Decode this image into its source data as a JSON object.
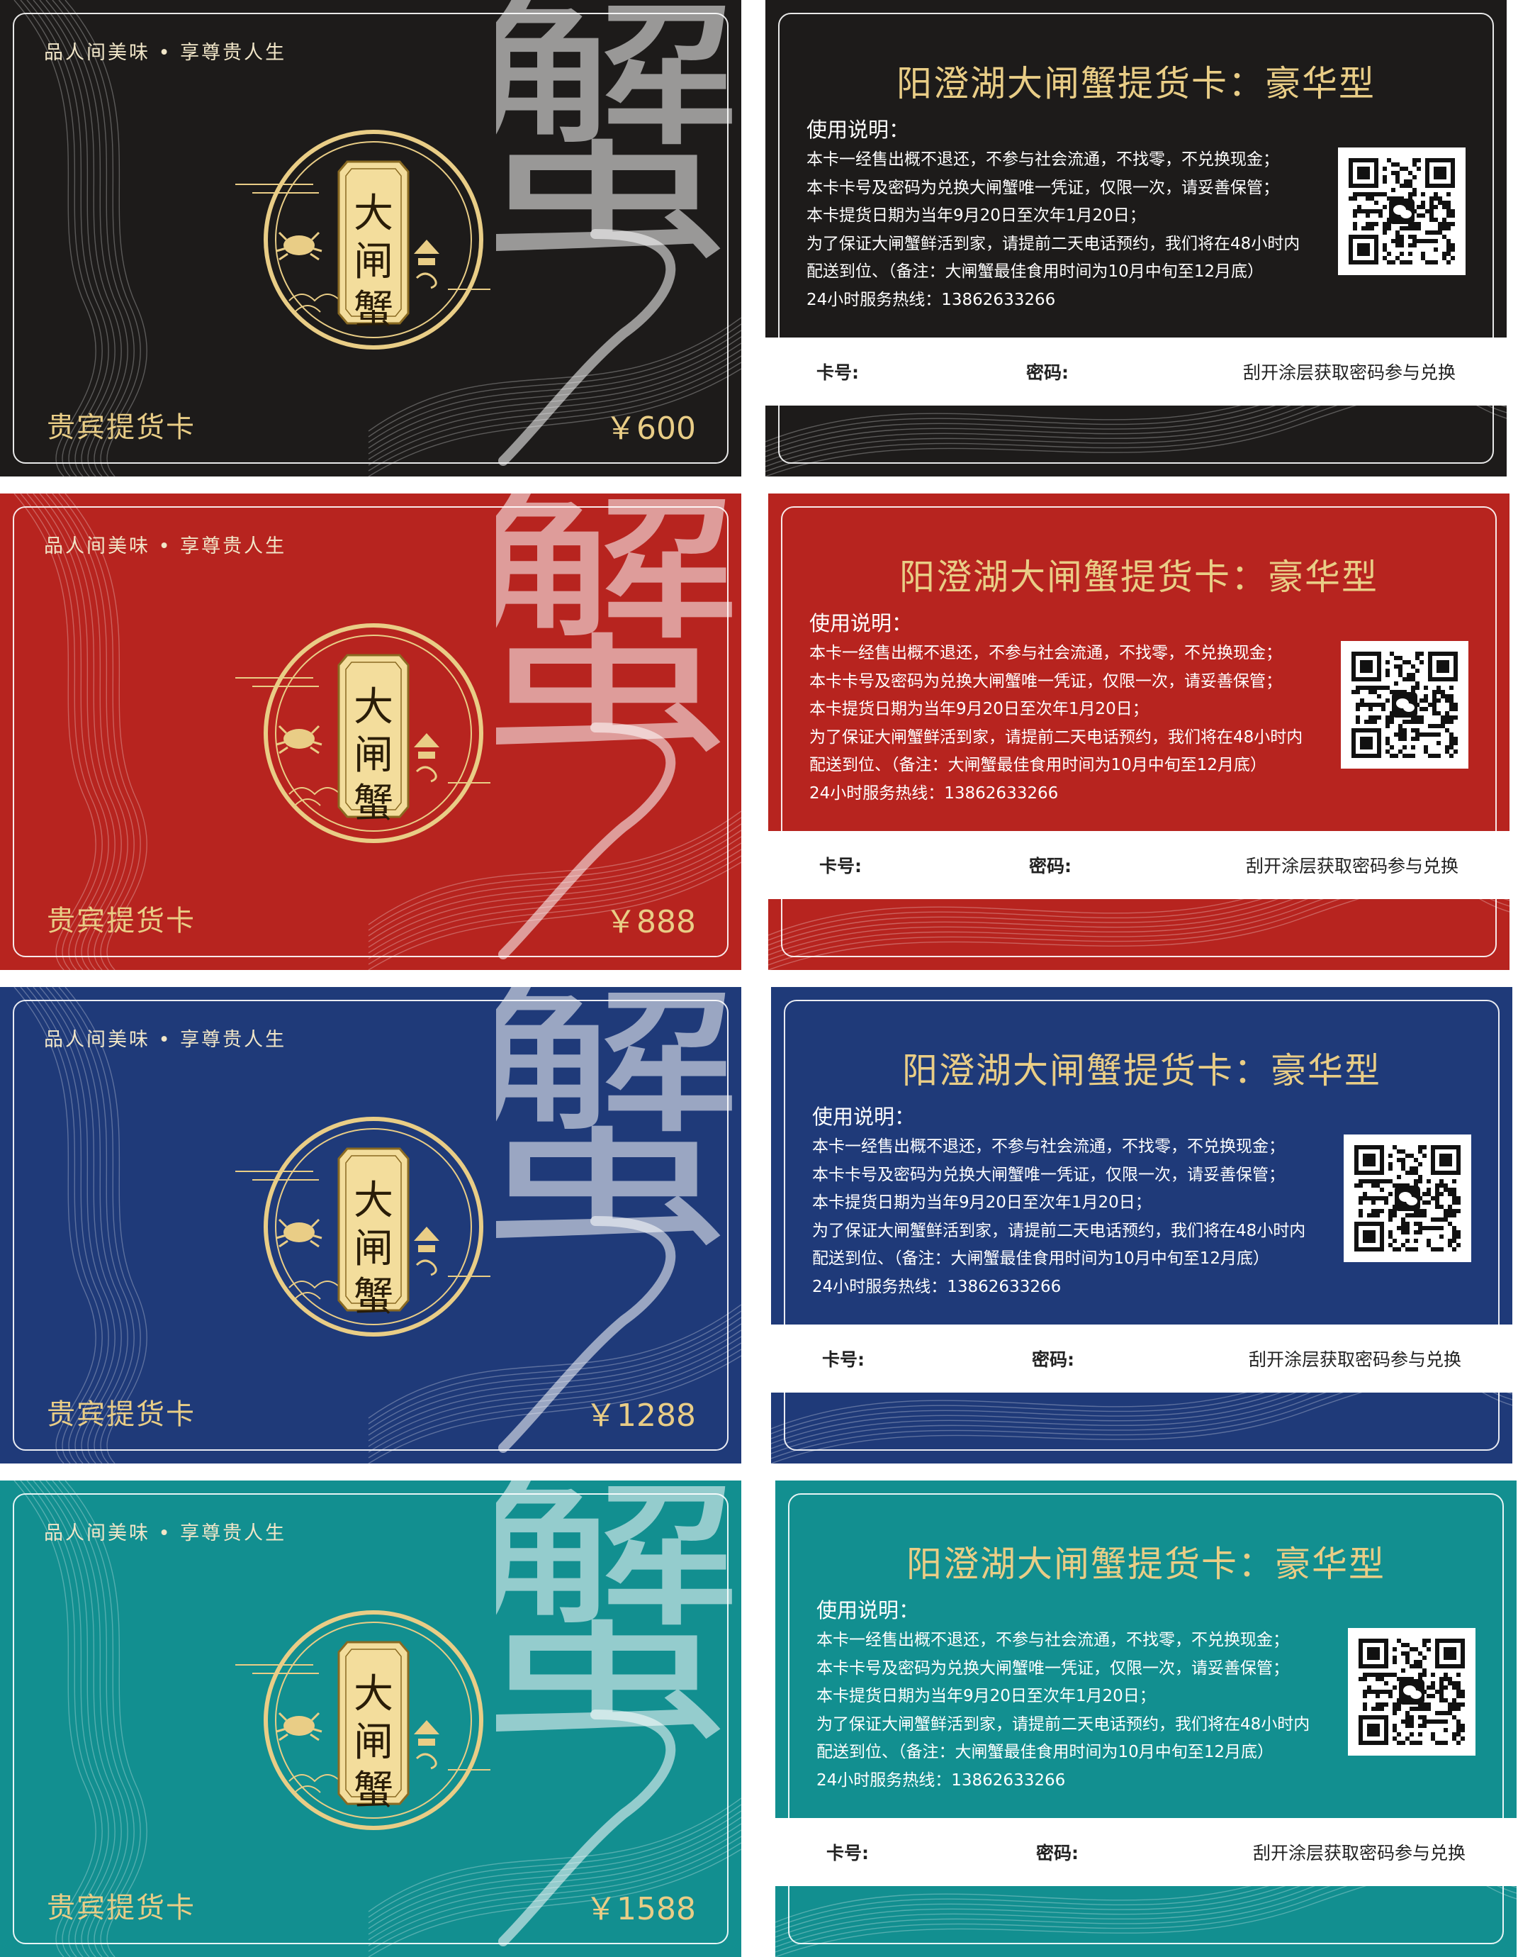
{
  "slogan": "品人间美味 • 享尊贵人生",
  "emblem_text": "大闸蟹",
  "callig_char": "蟹",
  "card_label": "贵宾提货卡",
  "back": {
    "title": "阳澄湖大闸蟹提货卡：豪华型",
    "instructions_heading": "使用说明：",
    "instructions": [
      "本卡一经售出概不退还，不参与社会流通，不找零，不兑换现金；",
      "本卡卡号及密码为兑换大闸蟹唯一凭证，仅限一次，请妥善保管；",
      "本卡提货日期为当年9月20日至次年1月20日；",
      "为了保证大闸蟹鲜活到家，请提前二天电话预约，我们将在48小时内",
      "配送到位、（备注：大闸蟹最佳食用时间为10月中旬至12月底）",
      "24小时服务热线：13862633266"
    ],
    "card_no_label": "卡号:",
    "password_label": "密码:",
    "scratch_hint": "刮开涂层获取密码参与兑换"
  },
  "colors": {
    "gold": "#e9cd86",
    "black": "#1d1b1a",
    "red": "#b7241f",
    "blue": "#1f3a79",
    "teal": "#128f90"
  },
  "cards": [
    {
      "price": "￥600",
      "color": "#1d1b1a"
    },
    {
      "price": "￥888",
      "color": "#b7241f"
    },
    {
      "price": "￥1288",
      "color": "#1f3a79"
    },
    {
      "price": "￥1588",
      "color": "#128f90"
    }
  ]
}
